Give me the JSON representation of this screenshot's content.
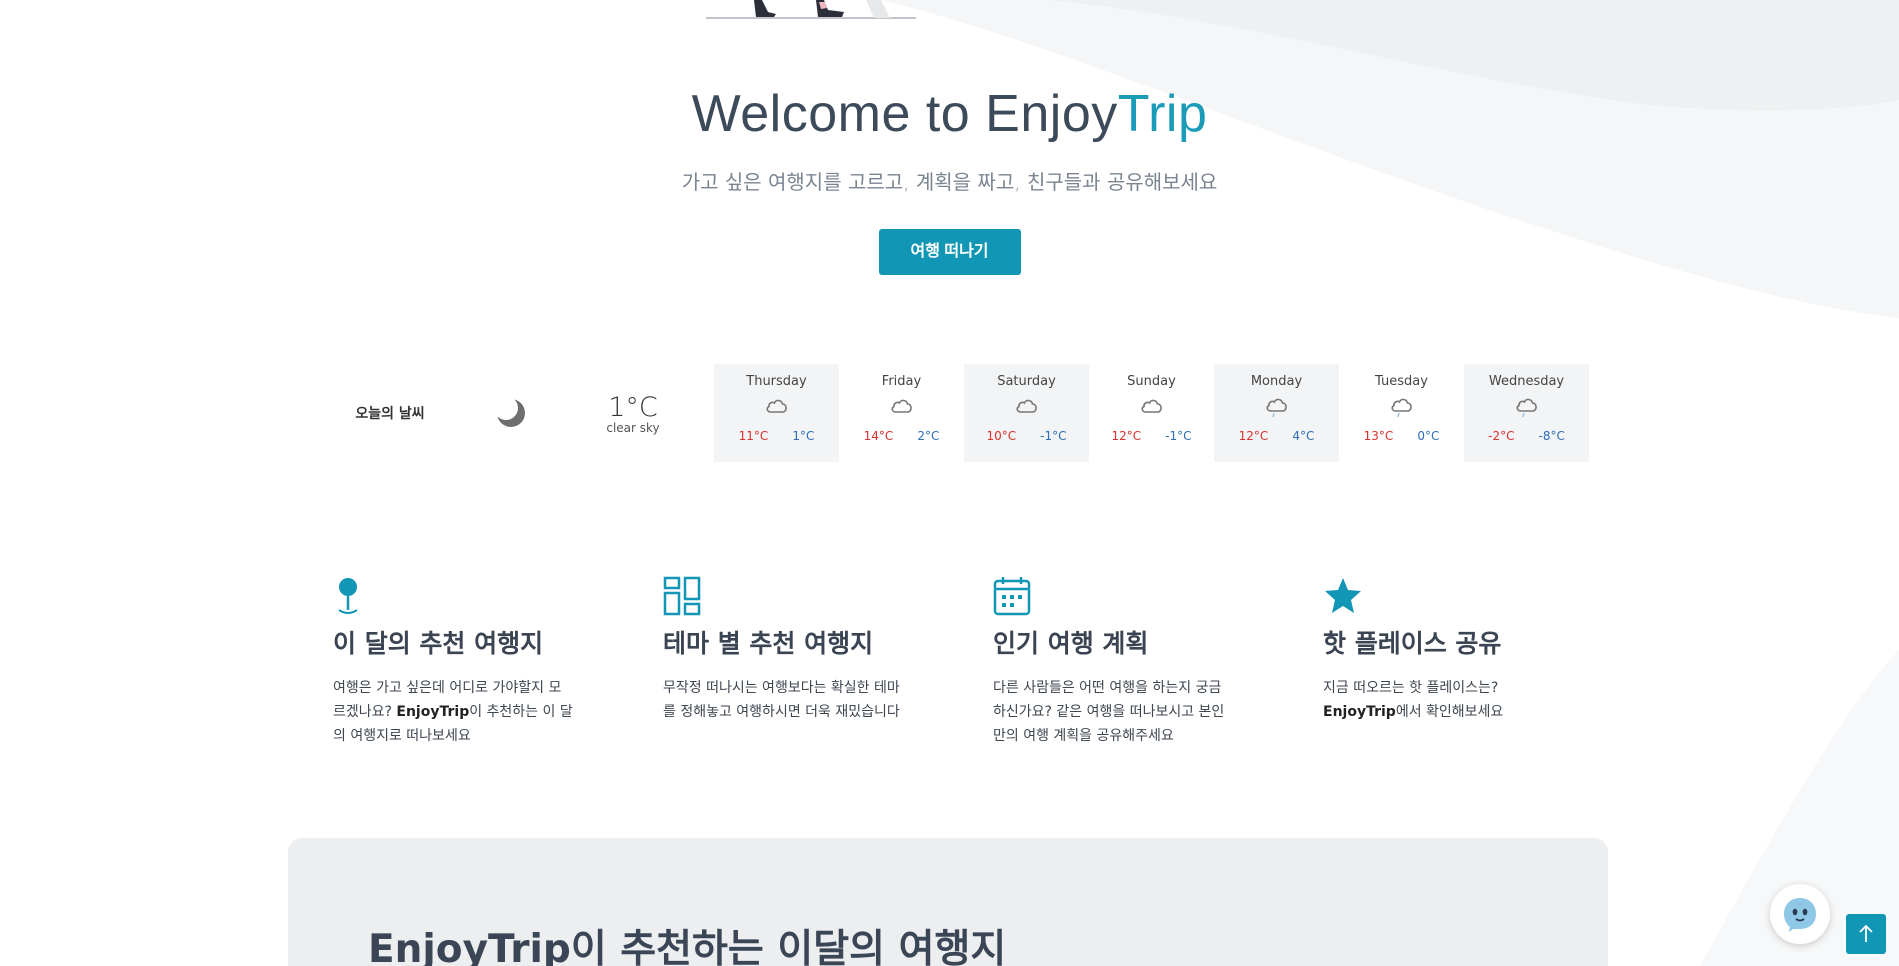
{
  "hero": {
    "title_main": "Welcome to Enjoy",
    "title_accent": "Trip",
    "subtitle": "가고 싶은 여행지를 고르고, 계획을 짜고, 친구들과 공유해보세요",
    "cta_label": "여행 떠나기"
  },
  "weather": {
    "label": "오늘의 날씨",
    "current_temp": "1°C",
    "current_desc": "clear sky",
    "current_icon": "moon-icon",
    "days": [
      {
        "name": "Thursday",
        "high": "11°C",
        "low": "1°C",
        "icon": "cloud-icon"
      },
      {
        "name": "Friday",
        "high": "14°C",
        "low": "2°C",
        "icon": "cloud-icon"
      },
      {
        "name": "Saturday",
        "high": "10°C",
        "low": "-1°C",
        "icon": "cloud-icon"
      },
      {
        "name": "Sunday",
        "high": "12°C",
        "low": "-1°C",
        "icon": "cloud-icon"
      },
      {
        "name": "Monday",
        "high": "12°C",
        "low": "4°C",
        "icon": "rain-cloud-icon"
      },
      {
        "name": "Tuesday",
        "high": "13°C",
        "low": "0°C",
        "icon": "rain-cloud-icon"
      },
      {
        "name": "Wednesday",
        "high": "-2°C",
        "low": "-8°C",
        "icon": "rain-cloud-icon"
      }
    ]
  },
  "features": [
    {
      "title": "이 달의 추천 여행지",
      "text_before": "여행은 가고 싶은데 어디로 가야할지 모르겠나요? ",
      "text_bold": "EnjoyTrip",
      "text_after": "이 추천하는 이 달의 여행지로 떠나보세요",
      "icon": "map-pin-icon"
    },
    {
      "title": "테마 별 추천 여행지",
      "text_before": "무작정 떠나시는 여행보다는 확실한 테마를 정해놓고 여행하시면 더욱 재밌습니다",
      "text_bold": "",
      "text_after": "",
      "icon": "grid-layout-icon"
    },
    {
      "title": "인기 여행 계획",
      "text_before": "다른 사람들은 어떤 여행을 하는지 궁금하신가요? 같은 여행을 떠나보시고 본인만의 여행 계획을 공유해주세요",
      "text_bold": "",
      "text_after": "",
      "icon": "calendar-icon"
    },
    {
      "title": "핫 플레이스 공유",
      "text_before": "지금 떠오르는 핫 플레이스는? ",
      "text_bold": "EnjoyTrip",
      "text_after": "에서 확인해보세요",
      "icon": "star-icon"
    }
  ],
  "recommend": {
    "title": "EnjoyTrip이 추천하는 이달의 여행지"
  },
  "colors": {
    "accent": "#1296b5",
    "high_temp": "#d9322e",
    "low_temp": "#2e6db8"
  }
}
